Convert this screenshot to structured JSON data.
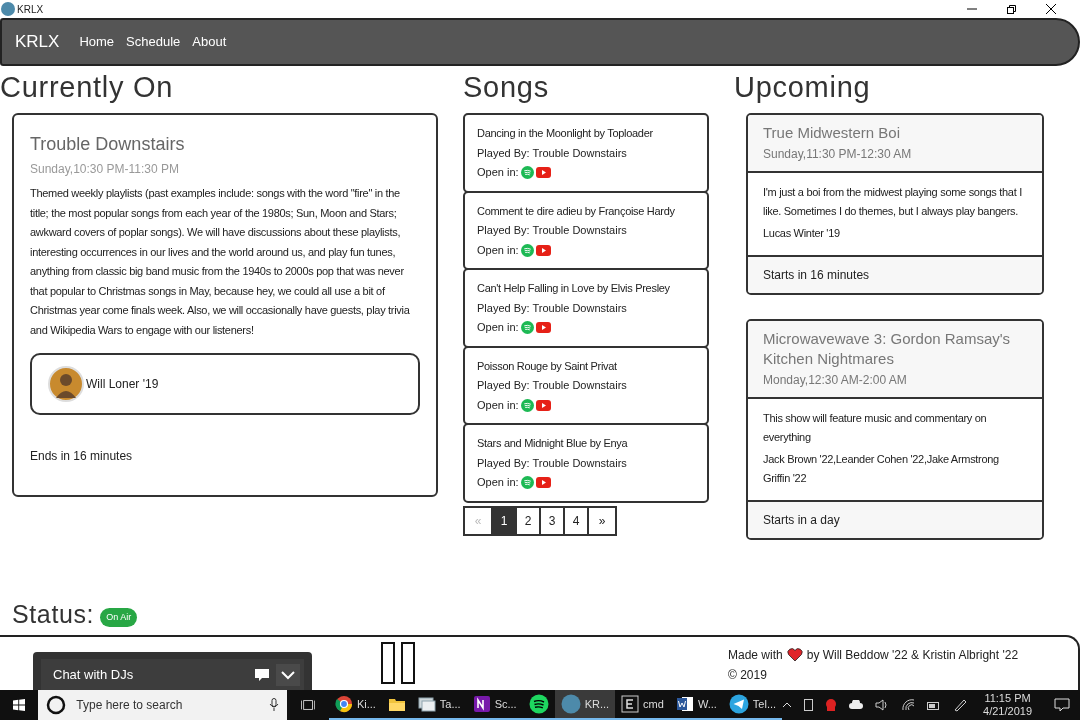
{
  "window": {
    "title": "KRLX"
  },
  "nav": {
    "brand": "KRLX",
    "links": [
      "Home",
      "Schedule",
      "About"
    ]
  },
  "currently_on": {
    "heading": "Currently On",
    "title": "Trouble Downstairs",
    "time": "Sunday,10:30 PM-11:30 PM",
    "description": "Themed weekly playlists (past examples include: songs with the word \"fire\" in the title; the most popular songs from each year of the 1980s; Sun, Moon and Stars; awkward covers of poplar songs). We will have discussions about these playlists, interesting occurrences in our lives and the world around us, and play fun tunes, anything from classic big band music from the 1940s to 2000s pop that was never that popular to Christmas songs in May, because hey, we could all use a bit of Christmas year come finals week. Also, we will occasionally have guests, play trivia and Wikipedia Wars to engage with our listeners!",
    "dj": "Will Loner '19",
    "ends": "Ends in 16 minutes"
  },
  "songs": {
    "heading": "Songs",
    "items": [
      {
        "title": "Dancing in the Moonlight by Toploader",
        "played_by": "Played By: Trouble Downstairs",
        "open_in": "Open in:"
      },
      {
        "title": "Comment te dire adieu by Françoise Hardy",
        "played_by": "Played By: Trouble Downstairs",
        "open_in": "Open in:"
      },
      {
        "title": "Can't Help Falling in Love by Elvis Presley",
        "played_by": "Played By: Trouble Downstairs",
        "open_in": "Open in:"
      },
      {
        "title": "Poisson Rouge by Saint Privat",
        "played_by": "Played By: Trouble Downstairs",
        "open_in": "Open in:"
      },
      {
        "title": "Stars and Midnight Blue by Enya",
        "played_by": "Played By: Trouble Downstairs",
        "open_in": "Open in:"
      }
    ],
    "pagination": [
      {
        "label": "«",
        "selected": false,
        "disabled": true
      },
      {
        "label": "1",
        "selected": true,
        "disabled": false
      },
      {
        "label": "2",
        "selected": false,
        "disabled": false
      },
      {
        "label": "3",
        "selected": false,
        "disabled": false
      },
      {
        "label": "4",
        "selected": false,
        "disabled": false
      },
      {
        "label": "»",
        "selected": false,
        "disabled": false
      }
    ]
  },
  "upcoming": {
    "heading": "Upcoming",
    "shows": [
      {
        "title": "True Midwestern Boi",
        "time": "Sunday,11:30 PM-12:30 AM",
        "description": "I'm just a boi from the midwest playing some songs that I like. Sometimes I do themes, but I always play bangers.",
        "djs": "Lucas Winter '19",
        "starts": "Starts in 16 minutes"
      },
      {
        "title": "Microwavewave 3: Gordon Ramsay's Kitchen Nightmares",
        "time": "Monday,12:30 AM-2:00 AM",
        "description": "This show will feature music and commentary on everything",
        "djs": "Jack Brown '22,Leander Cohen '22,Jake Armstrong Griffin '22",
        "starts": "Starts in a day"
      }
    ]
  },
  "status": {
    "label": "Status:",
    "badge": "On Air"
  },
  "footer": {
    "made_with": "Made with",
    "credits": "by Will Beddow '22 & Kristin Albright '22",
    "copyright": "© 2019"
  },
  "chat": {
    "title": "Chat with DJs"
  },
  "taskbar": {
    "search_placeholder": "Type here to search",
    "apps": [
      {
        "label": "Ki...",
        "selected": false
      },
      {
        "selected": false
      },
      {
        "label": "Ta...",
        "selected": false
      },
      {
        "label": "Sc...",
        "selected": false
      },
      {
        "selected": false
      },
      {
        "label": "KR...",
        "selected": true
      },
      {
        "label": "cmd",
        "selected": false
      },
      {
        "label": "W...",
        "selected": false
      },
      {
        "label": "Tel...",
        "selected": false
      }
    ],
    "time": "11:15 PM",
    "date": "4/21/2019"
  }
}
